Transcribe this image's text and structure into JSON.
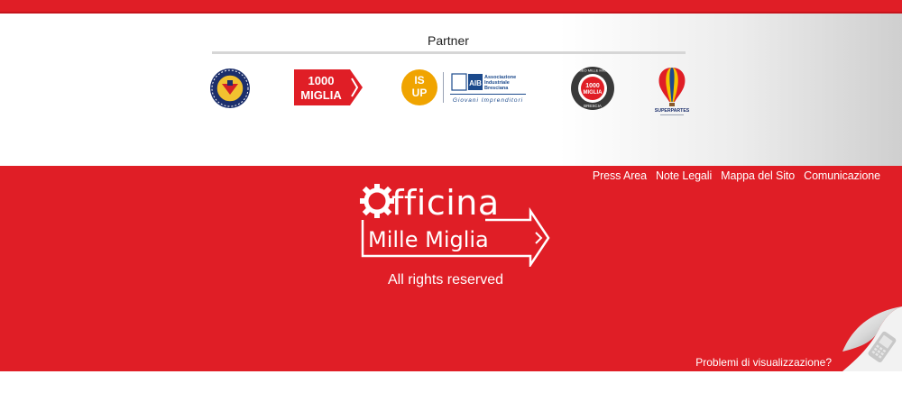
{
  "partners": {
    "title": "Partner",
    "logos": [
      {
        "name": "aci-brescia-logo"
      },
      {
        "name": "1000-miglia-logo",
        "line1": "1000",
        "line2": "MIGLIA"
      },
      {
        "name": "isup-aib-logo",
        "isup_top": "IS",
        "isup_bottom": "UP",
        "aib_abbr": "AIB",
        "aib_line1": "Associazione",
        "aib_line2": "Industriale",
        "aib_line3": "Bresciana",
        "aib_sub": "Giovani Imprenditori"
      },
      {
        "name": "museo-mille-miglia-logo",
        "ring_top": "MUSEO MILLE MIGLIA",
        "center_1": "1000",
        "center_2": "MIGLIA",
        "ring_bottom": "BRESCIA"
      },
      {
        "name": "superpartes-logo",
        "label": "SUPERPARTES"
      }
    ]
  },
  "footer": {
    "nav": [
      {
        "label": "Press Area"
      },
      {
        "label": "Note Legali"
      },
      {
        "label": "Mappa del Sito"
      },
      {
        "label": "Comunicazione"
      }
    ],
    "brand": {
      "word1_rest": "fficina",
      "word2": "Mille Miglia"
    },
    "rights": "All rights reserved",
    "problems": "Problemi di visualizzazione?"
  },
  "colors": {
    "brand_red": "#e01e26",
    "white": "#ffffff"
  }
}
